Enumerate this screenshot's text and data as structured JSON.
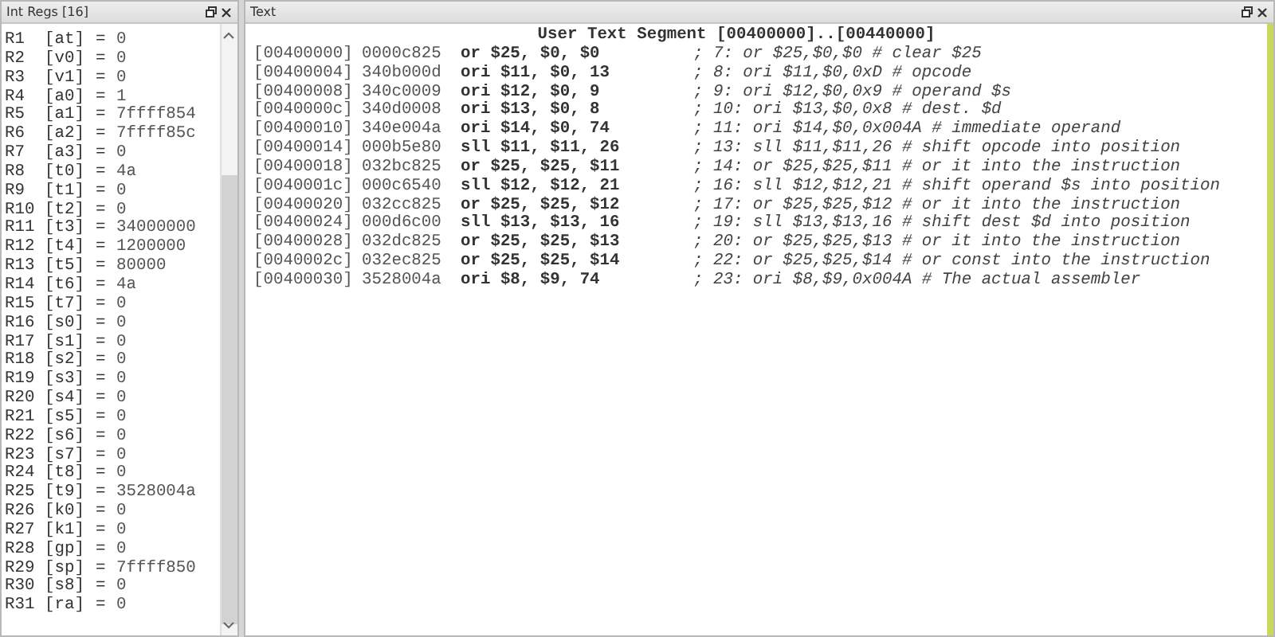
{
  "registers_panel": {
    "title": "Int Regs [16]",
    "registers": [
      {
        "reg": "R1",
        "name": "[at]",
        "equals": "=",
        "value": "0"
      },
      {
        "reg": "R2",
        "name": "[v0]",
        "equals": "=",
        "value": "0"
      },
      {
        "reg": "R3",
        "name": "[v1]",
        "equals": "=",
        "value": "0"
      },
      {
        "reg": "R4",
        "name": "[a0]",
        "equals": "=",
        "value": "1"
      },
      {
        "reg": "R5",
        "name": "[a1]",
        "equals": "=",
        "value": "7ffff854"
      },
      {
        "reg": "R6",
        "name": "[a2]",
        "equals": "=",
        "value": "7ffff85c"
      },
      {
        "reg": "R7",
        "name": "[a3]",
        "equals": "=",
        "value": "0"
      },
      {
        "reg": "R8",
        "name": "[t0]",
        "equals": "=",
        "value": "4a"
      },
      {
        "reg": "R9",
        "name": "[t1]",
        "equals": "=",
        "value": "0"
      },
      {
        "reg": "R10",
        "name": "[t2]",
        "equals": "=",
        "value": "0"
      },
      {
        "reg": "R11",
        "name": "[t3]",
        "equals": "=",
        "value": "34000000"
      },
      {
        "reg": "R12",
        "name": "[t4]",
        "equals": "=",
        "value": "1200000"
      },
      {
        "reg": "R13",
        "name": "[t5]",
        "equals": "=",
        "value": "80000"
      },
      {
        "reg": "R14",
        "name": "[t6]",
        "equals": "=",
        "value": "4a"
      },
      {
        "reg": "R15",
        "name": "[t7]",
        "equals": "=",
        "value": "0"
      },
      {
        "reg": "R16",
        "name": "[s0]",
        "equals": "=",
        "value": "0"
      },
      {
        "reg": "R17",
        "name": "[s1]",
        "equals": "=",
        "value": "0"
      },
      {
        "reg": "R18",
        "name": "[s2]",
        "equals": "=",
        "value": "0"
      },
      {
        "reg": "R19",
        "name": "[s3]",
        "equals": "=",
        "value": "0"
      },
      {
        "reg": "R20",
        "name": "[s4]",
        "equals": "=",
        "value": "0"
      },
      {
        "reg": "R21",
        "name": "[s5]",
        "equals": "=",
        "value": "0"
      },
      {
        "reg": "R22",
        "name": "[s6]",
        "equals": "=",
        "value": "0"
      },
      {
        "reg": "R23",
        "name": "[s7]",
        "equals": "=",
        "value": "0"
      },
      {
        "reg": "R24",
        "name": "[t8]",
        "equals": "=",
        "value": "0"
      },
      {
        "reg": "R25",
        "name": "[t9]",
        "equals": "=",
        "value": "3528004a"
      },
      {
        "reg": "R26",
        "name": "[k0]",
        "equals": "=",
        "value": "0"
      },
      {
        "reg": "R27",
        "name": "[k1]",
        "equals": "=",
        "value": "0"
      },
      {
        "reg": "R28",
        "name": "[gp]",
        "equals": "=",
        "value": "0"
      },
      {
        "reg": "R29",
        "name": "[sp]",
        "equals": "=",
        "value": "7ffff850"
      },
      {
        "reg": "R30",
        "name": "[s8]",
        "equals": "=",
        "value": "0"
      },
      {
        "reg": "R31",
        "name": "[ra]",
        "equals": "=",
        "value": "0"
      }
    ]
  },
  "text_panel": {
    "title": "Text",
    "segment_header": "User Text Segment [00400000]..[00440000]",
    "lines": [
      {
        "address": "[00400000]",
        "code": "0000c825",
        "instruction": "or $25, $0, $0",
        "comment": "; 7: or $25,$0,$0 # clear $25"
      },
      {
        "address": "[00400004]",
        "code": "340b000d",
        "instruction": "ori $11, $0, 13",
        "comment": "; 8: ori $11,$0,0xD # opcode"
      },
      {
        "address": "[00400008]",
        "code": "340c0009",
        "instruction": "ori $12, $0, 9",
        "comment": "; 9: ori $12,$0,0x9 # operand $s"
      },
      {
        "address": "[0040000c]",
        "code": "340d0008",
        "instruction": "ori $13, $0, 8",
        "comment": "; 10: ori $13,$0,0x8 # dest. $d"
      },
      {
        "address": "[00400010]",
        "code": "340e004a",
        "instruction": "ori $14, $0, 74",
        "comment": "; 11: ori $14,$0,0x004A # immediate operand"
      },
      {
        "address": "[00400014]",
        "code": "000b5e80",
        "instruction": "sll $11, $11, 26",
        "comment": "; 13: sll $11,$11,26 # shift opcode into position"
      },
      {
        "address": "[00400018]",
        "code": "032bc825",
        "instruction": "or $25, $25, $11",
        "comment": "; 14: or $25,$25,$11 # or it into the instruction"
      },
      {
        "address": "[0040001c]",
        "code": "000c6540",
        "instruction": "sll $12, $12, 21",
        "comment": "; 16: sll $12,$12,21 # shift operand $s into position"
      },
      {
        "address": "[00400020]",
        "code": "032cc825",
        "instruction": "or $25, $25, $12",
        "comment": "; 17: or $25,$25,$12 # or it into the instruction"
      },
      {
        "address": "[00400024]",
        "code": "000d6c00",
        "instruction": "sll $13, $13, 16",
        "comment": "; 19: sll $13,$13,16 # shift dest $d into position"
      },
      {
        "address": "[00400028]",
        "code": "032dc825",
        "instruction": "or $25, $25, $13",
        "comment": "; 20: or $25,$25,$13 # or it into the instruction"
      },
      {
        "address": "[0040002c]",
        "code": "032ec825",
        "instruction": "or $25, $25, $14",
        "comment": "; 22: or $25,$25,$14 # or const into the instruction"
      },
      {
        "address": "[00400030]",
        "code": "3528004a",
        "instruction": "ori $8, $9, 74",
        "comment": "; 23: ori $8,$9,0x004A # The actual assembler"
      }
    ]
  }
}
